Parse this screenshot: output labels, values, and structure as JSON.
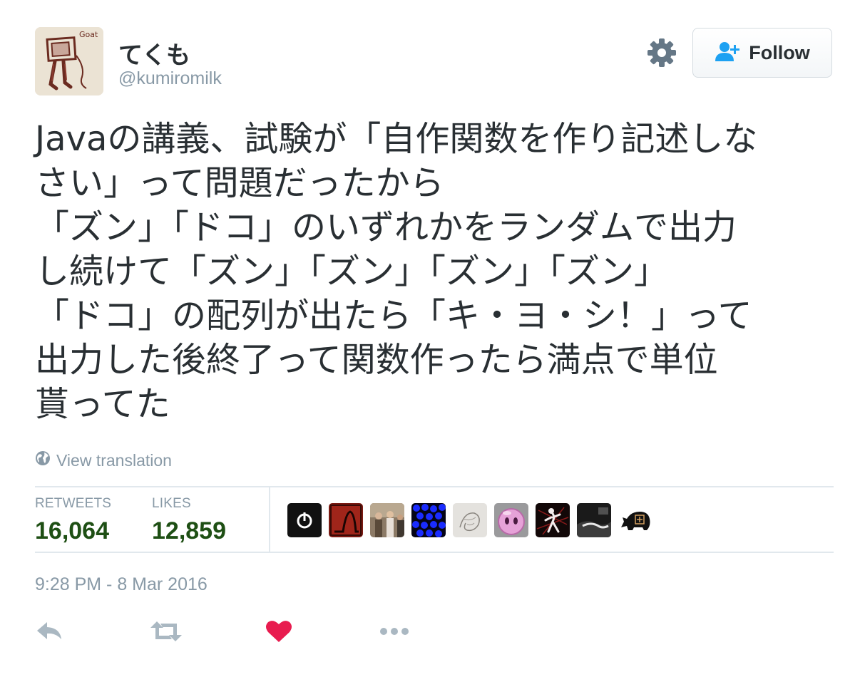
{
  "user": {
    "display_name": "てくも",
    "handle": "@kumiromilk",
    "avatar_text": "Goat"
  },
  "header": {
    "settings_icon": "gear-icon",
    "follow_label": "Follow",
    "follow_icon": "add-user-icon"
  },
  "tweet": {
    "lines": [
      "Javaの講義、試験が「自作関数を作り記述しな",
      "さい」って問題だったから",
      "「ズン」「ドコ」のいずれかをランダムで出力",
      "し続けて「ズン」「ズン」「ズン」「ズン」",
      "「ドコ」の配列が出たら「キ・ヨ・シ！」って",
      "出力した後終了って関数作ったら満点で単位",
      "貰ってた"
    ],
    "translate_label": "View translation"
  },
  "stats": {
    "retweets_label": "RETWEETS",
    "retweets_value": "16,064",
    "likes_label": "LIKES",
    "likes_value": "12,859"
  },
  "likers": [
    "power-avatar",
    "red-shark-avatar",
    "people-photo-avatar",
    "blue-dots-avatar",
    "sketch-avatar",
    "pink-ball-avatar",
    "anime-dark-avatar",
    "dark-photo-avatar",
    "rhino-avatar"
  ],
  "timestamp": "9:28 PM - 8 Mar 2016",
  "actions": [
    "reply-icon",
    "retweet-icon",
    "like-icon",
    "more-icon"
  ],
  "colors": {
    "text": "#292f33",
    "muted": "#8899a6",
    "stat_value": "#1e4f14",
    "like_red": "#e81c4f",
    "accent_blue": "#1da1f2",
    "divider": "#e1e8ed"
  }
}
